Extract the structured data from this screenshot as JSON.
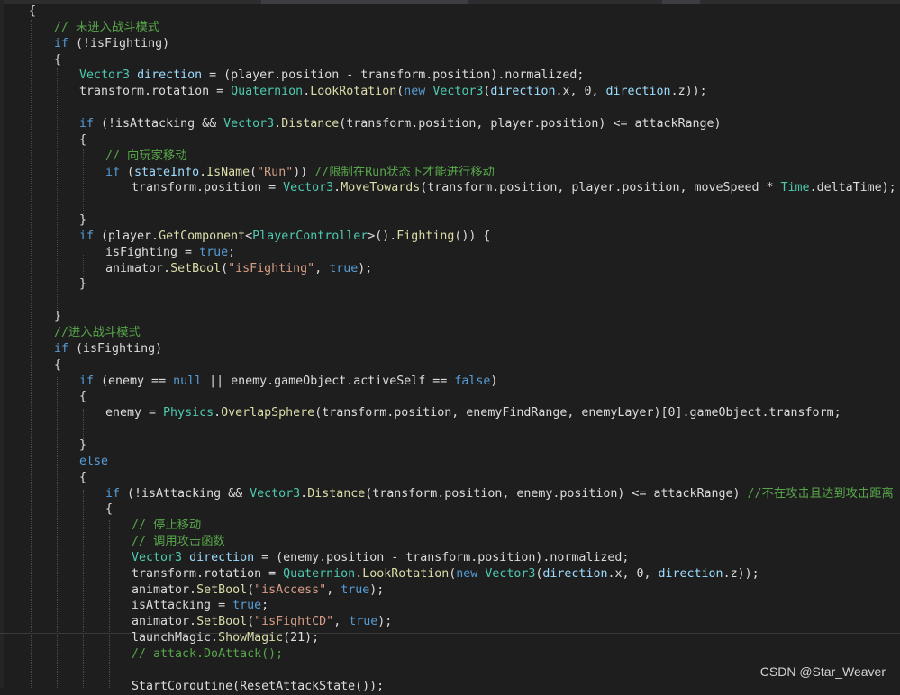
{
  "editor": {
    "lines": [
      {
        "indent": 32,
        "tokens": [
          {
            "c": "txt",
            "t": "{"
          }
        ]
      },
      {
        "indent": 60,
        "tokens": [
          {
            "c": "cm",
            "t": "// 未进入战斗模式"
          }
        ]
      },
      {
        "indent": 60,
        "tokens": [
          {
            "c": "kw",
            "t": "if"
          },
          {
            "c": "txt",
            "t": " (!isFighting)"
          }
        ]
      },
      {
        "indent": 60,
        "tokens": [
          {
            "c": "txt",
            "t": "{"
          }
        ]
      },
      {
        "indent": 88,
        "tokens": [
          {
            "c": "ty",
            "t": "Vector3"
          },
          {
            "c": "txt",
            "t": " "
          },
          {
            "c": "var",
            "t": "direction"
          },
          {
            "c": "txt",
            "t": " = (player.position - transform.position).normalized;"
          }
        ]
      },
      {
        "indent": 88,
        "tokens": [
          {
            "c": "txt",
            "t": "transform.rotation = "
          },
          {
            "c": "ty",
            "t": "Quaternion"
          },
          {
            "c": "txt",
            "t": "."
          },
          {
            "c": "fn",
            "t": "LookRotation"
          },
          {
            "c": "txt",
            "t": "("
          },
          {
            "c": "kw",
            "t": "new"
          },
          {
            "c": "txt",
            "t": " "
          },
          {
            "c": "ty",
            "t": "Vector3"
          },
          {
            "c": "txt",
            "t": "("
          },
          {
            "c": "var",
            "t": "direction"
          },
          {
            "c": "txt",
            "t": ".x, 0, "
          },
          {
            "c": "var",
            "t": "direction"
          },
          {
            "c": "txt",
            "t": ".z));"
          }
        ]
      },
      {
        "indent": 88,
        "tokens": []
      },
      {
        "indent": 88,
        "tokens": [
          {
            "c": "kw",
            "t": "if"
          },
          {
            "c": "txt",
            "t": " (!isAttacking && "
          },
          {
            "c": "ty",
            "t": "Vector3"
          },
          {
            "c": "txt",
            "t": "."
          },
          {
            "c": "fn",
            "t": "Distance"
          },
          {
            "c": "txt",
            "t": "(transform.position, player.position) <= attackRange)"
          }
        ]
      },
      {
        "indent": 88,
        "tokens": [
          {
            "c": "txt",
            "t": "{"
          }
        ]
      },
      {
        "indent": 117,
        "tokens": [
          {
            "c": "cm",
            "t": "// 向玩家移动"
          }
        ]
      },
      {
        "indent": 117,
        "tokens": [
          {
            "c": "kw",
            "t": "if"
          },
          {
            "c": "txt",
            "t": " ("
          },
          {
            "c": "var",
            "t": "stateInfo"
          },
          {
            "c": "txt",
            "t": "."
          },
          {
            "c": "fn",
            "t": "IsName"
          },
          {
            "c": "txt",
            "t": "("
          },
          {
            "c": "str",
            "t": "\"Run\""
          },
          {
            "c": "txt",
            "t": ")) "
          },
          {
            "c": "cm",
            "t": "//限制在Run状态下才能进行移动"
          }
        ]
      },
      {
        "indent": 146,
        "tokens": [
          {
            "c": "txt",
            "t": "transform.position = "
          },
          {
            "c": "ty",
            "t": "Vector3"
          },
          {
            "c": "txt",
            "t": "."
          },
          {
            "c": "fn",
            "t": "MoveTowards"
          },
          {
            "c": "txt",
            "t": "(transform.position, player.position, moveSpeed * "
          },
          {
            "c": "ty",
            "t": "Time"
          },
          {
            "c": "txt",
            "t": ".deltaTime);"
          }
        ]
      },
      {
        "indent": 88,
        "tokens": []
      },
      {
        "indent": 88,
        "tokens": [
          {
            "c": "txt",
            "t": "}"
          }
        ]
      },
      {
        "indent": 88,
        "tokens": [
          {
            "c": "kw",
            "t": "if"
          },
          {
            "c": "txt",
            "t": " (player."
          },
          {
            "c": "fn",
            "t": "GetComponent"
          },
          {
            "c": "txt",
            "t": "<"
          },
          {
            "c": "ty",
            "t": "PlayerController"
          },
          {
            "c": "txt",
            "t": ">()."
          },
          {
            "c": "fn",
            "t": "Fighting"
          },
          {
            "c": "txt",
            "t": "()) {"
          }
        ]
      },
      {
        "indent": 117,
        "tokens": [
          {
            "c": "txt",
            "t": "isFighting = "
          },
          {
            "c": "kw",
            "t": "true"
          },
          {
            "c": "txt",
            "t": ";"
          }
        ]
      },
      {
        "indent": 117,
        "tokens": [
          {
            "c": "txt",
            "t": "animator."
          },
          {
            "c": "fn",
            "t": "SetBool"
          },
          {
            "c": "txt",
            "t": "("
          },
          {
            "c": "str",
            "t": "\"isFighting\""
          },
          {
            "c": "txt",
            "t": ", "
          },
          {
            "c": "kw",
            "t": "true"
          },
          {
            "c": "txt",
            "t": ");"
          }
        ]
      },
      {
        "indent": 88,
        "tokens": [
          {
            "c": "txt",
            "t": "}"
          }
        ]
      },
      {
        "indent": 60,
        "tokens": []
      },
      {
        "indent": 60,
        "tokens": [
          {
            "c": "txt",
            "t": "}"
          }
        ]
      },
      {
        "indent": 60,
        "tokens": [
          {
            "c": "cm",
            "t": "//进入战斗模式"
          }
        ]
      },
      {
        "indent": 60,
        "tokens": [
          {
            "c": "kw",
            "t": "if"
          },
          {
            "c": "txt",
            "t": " (isFighting)"
          }
        ]
      },
      {
        "indent": 60,
        "tokens": [
          {
            "c": "txt",
            "t": "{"
          }
        ]
      },
      {
        "indent": 88,
        "tokens": [
          {
            "c": "kw",
            "t": "if"
          },
          {
            "c": "txt",
            "t": " (enemy == "
          },
          {
            "c": "kw",
            "t": "null"
          },
          {
            "c": "txt",
            "t": " || enemy.gameObject.activeSelf == "
          },
          {
            "c": "kw",
            "t": "false"
          },
          {
            "c": "txt",
            "t": ")"
          }
        ]
      },
      {
        "indent": 88,
        "tokens": [
          {
            "c": "txt",
            "t": "{"
          }
        ]
      },
      {
        "indent": 117,
        "tokens": [
          {
            "c": "txt",
            "t": "enemy = "
          },
          {
            "c": "ty",
            "t": "Physics"
          },
          {
            "c": "txt",
            "t": "."
          },
          {
            "c": "fn",
            "t": "OverlapSphere"
          },
          {
            "c": "txt",
            "t": "(transform.position, enemyFindRange, enemyLayer)[0].gameObject.transform;"
          }
        ]
      },
      {
        "indent": 88,
        "tokens": []
      },
      {
        "indent": 88,
        "tokens": [
          {
            "c": "txt",
            "t": "}"
          }
        ]
      },
      {
        "indent": 88,
        "tokens": [
          {
            "c": "kw",
            "t": "else"
          }
        ]
      },
      {
        "indent": 88,
        "tokens": [
          {
            "c": "txt",
            "t": "{"
          }
        ]
      },
      {
        "indent": 117,
        "tokens": [
          {
            "c": "kw",
            "t": "if"
          },
          {
            "c": "txt",
            "t": " (!isAttacking && "
          },
          {
            "c": "ty",
            "t": "Vector3"
          },
          {
            "c": "txt",
            "t": "."
          },
          {
            "c": "fn",
            "t": "Distance"
          },
          {
            "c": "txt",
            "t": "(transform.position, enemy.position) <= attackRange) "
          },
          {
            "c": "cm",
            "t": "//不在攻击且达到攻击距离"
          }
        ]
      },
      {
        "indent": 117,
        "tokens": [
          {
            "c": "txt",
            "t": "{"
          }
        ]
      },
      {
        "indent": 146,
        "tokens": [
          {
            "c": "cm",
            "t": "// 停止移动"
          }
        ]
      },
      {
        "indent": 146,
        "tokens": [
          {
            "c": "cm",
            "t": "// 调用攻击函数"
          }
        ]
      },
      {
        "indent": 146,
        "tokens": [
          {
            "c": "ty",
            "t": "Vector3"
          },
          {
            "c": "txt",
            "t": " "
          },
          {
            "c": "var",
            "t": "direction"
          },
          {
            "c": "txt",
            "t": " = (enemy.position - transform.position).normalized;"
          }
        ]
      },
      {
        "indent": 146,
        "tokens": [
          {
            "c": "txt",
            "t": "transform.rotation = "
          },
          {
            "c": "ty",
            "t": "Quaternion"
          },
          {
            "c": "txt",
            "t": "."
          },
          {
            "c": "fn",
            "t": "LookRotation"
          },
          {
            "c": "txt",
            "t": "("
          },
          {
            "c": "kw",
            "t": "new"
          },
          {
            "c": "txt",
            "t": " "
          },
          {
            "c": "ty",
            "t": "Vector3"
          },
          {
            "c": "txt",
            "t": "("
          },
          {
            "c": "var",
            "t": "direction"
          },
          {
            "c": "txt",
            "t": ".x, 0, "
          },
          {
            "c": "var",
            "t": "direction"
          },
          {
            "c": "txt",
            "t": ".z));"
          }
        ]
      },
      {
        "indent": 146,
        "tokens": [
          {
            "c": "txt",
            "t": "animator."
          },
          {
            "c": "fn",
            "t": "SetBool"
          },
          {
            "c": "txt",
            "t": "("
          },
          {
            "c": "str",
            "t": "\"isAccess\""
          },
          {
            "c": "txt",
            "t": ", "
          },
          {
            "c": "kw",
            "t": "true"
          },
          {
            "c": "txt",
            "t": ");"
          }
        ]
      },
      {
        "indent": 146,
        "tokens": [
          {
            "c": "txt",
            "t": "isAttacking = "
          },
          {
            "c": "kw",
            "t": "true"
          },
          {
            "c": "txt",
            "t": ";"
          }
        ]
      },
      {
        "indent": 146,
        "tokens": [
          {
            "c": "txt",
            "t": "animator."
          },
          {
            "c": "fn",
            "t": "SetBool"
          },
          {
            "c": "txt",
            "t": "("
          },
          {
            "c": "str",
            "t": "\"isFightCD\""
          },
          {
            "c": "txt",
            "t": ","
          },
          {
            "c": "caret",
            "t": ""
          },
          {
            "c": "txt",
            "t": " "
          },
          {
            "c": "kw",
            "t": "true"
          },
          {
            "c": "txt",
            "t": ");"
          }
        ]
      },
      {
        "indent": 146,
        "tokens": [
          {
            "c": "txt",
            "t": "launchMagic."
          },
          {
            "c": "fn",
            "t": "ShowMagic"
          },
          {
            "c": "txt",
            "t": "(21);"
          }
        ]
      },
      {
        "indent": 146,
        "tokens": [
          {
            "c": "cm",
            "t": "// attack.DoAttack();"
          }
        ]
      },
      {
        "indent": 146,
        "tokens": []
      },
      {
        "indent": 146,
        "tokens": [
          {
            "c": "txt",
            "t": "StartCoroutine(ResetAttackState());"
          }
        ]
      }
    ]
  },
  "watermark": "CSDN @Star_Weaver"
}
